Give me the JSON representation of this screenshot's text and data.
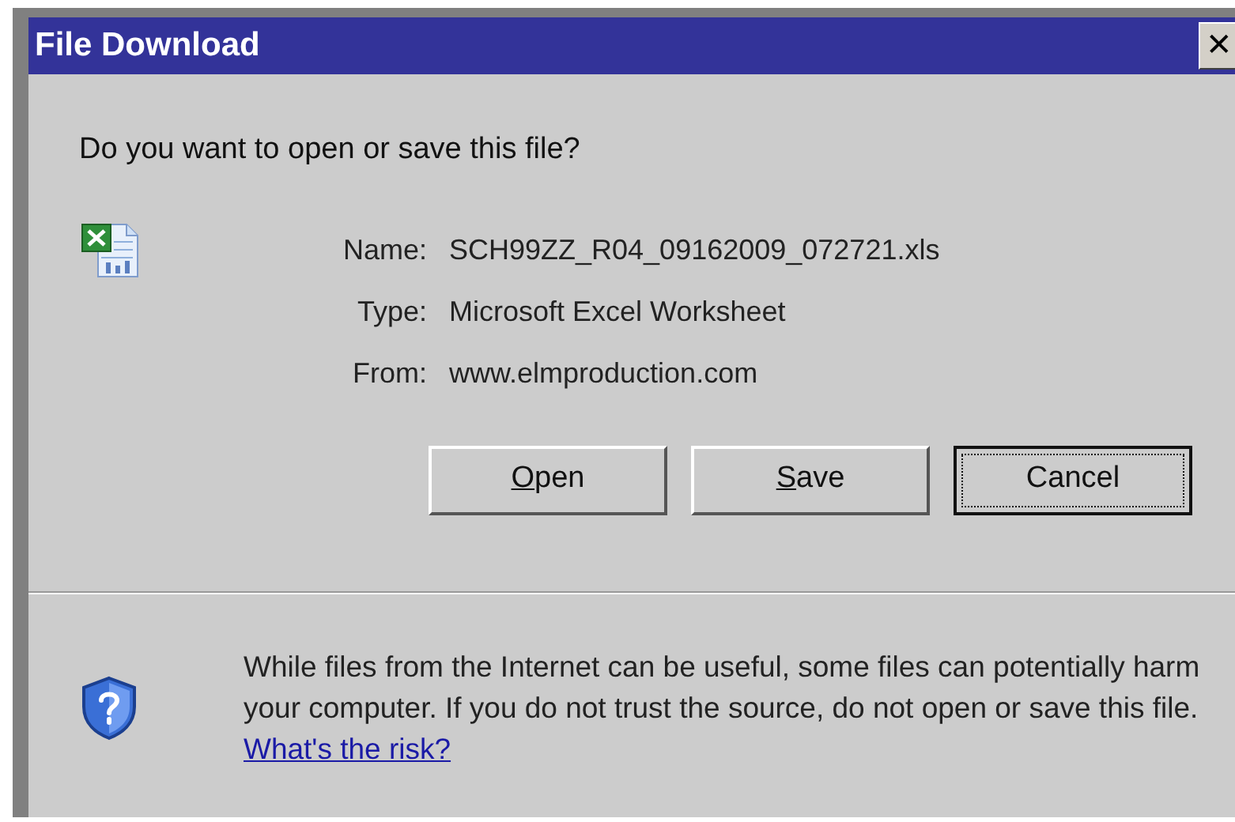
{
  "window": {
    "title": "File Download",
    "close": "✕"
  },
  "question": "Do you want to open or save this file?",
  "file_info": [
    {
      "label": "Name:",
      "value": "SCH99ZZ_R04_09162009_072721.xls"
    },
    {
      "label": "Type:",
      "value": "Microsoft Excel Worksheet"
    },
    {
      "label": "From:",
      "value": "www.elmproduction.com"
    }
  ],
  "buttons": [
    {
      "key_letter": "O",
      "rest": "pen",
      "focused": false
    },
    {
      "key_letter": "S",
      "rest": "ave",
      "focused": false
    },
    {
      "rest": "Cancel",
      "focused": true
    }
  ],
  "warning": {
    "text": "While files from the Internet can be useful, some files can potentially harm your computer. If you do not trust the source, do not open or save this file.",
    "link": "What's the risk?"
  }
}
